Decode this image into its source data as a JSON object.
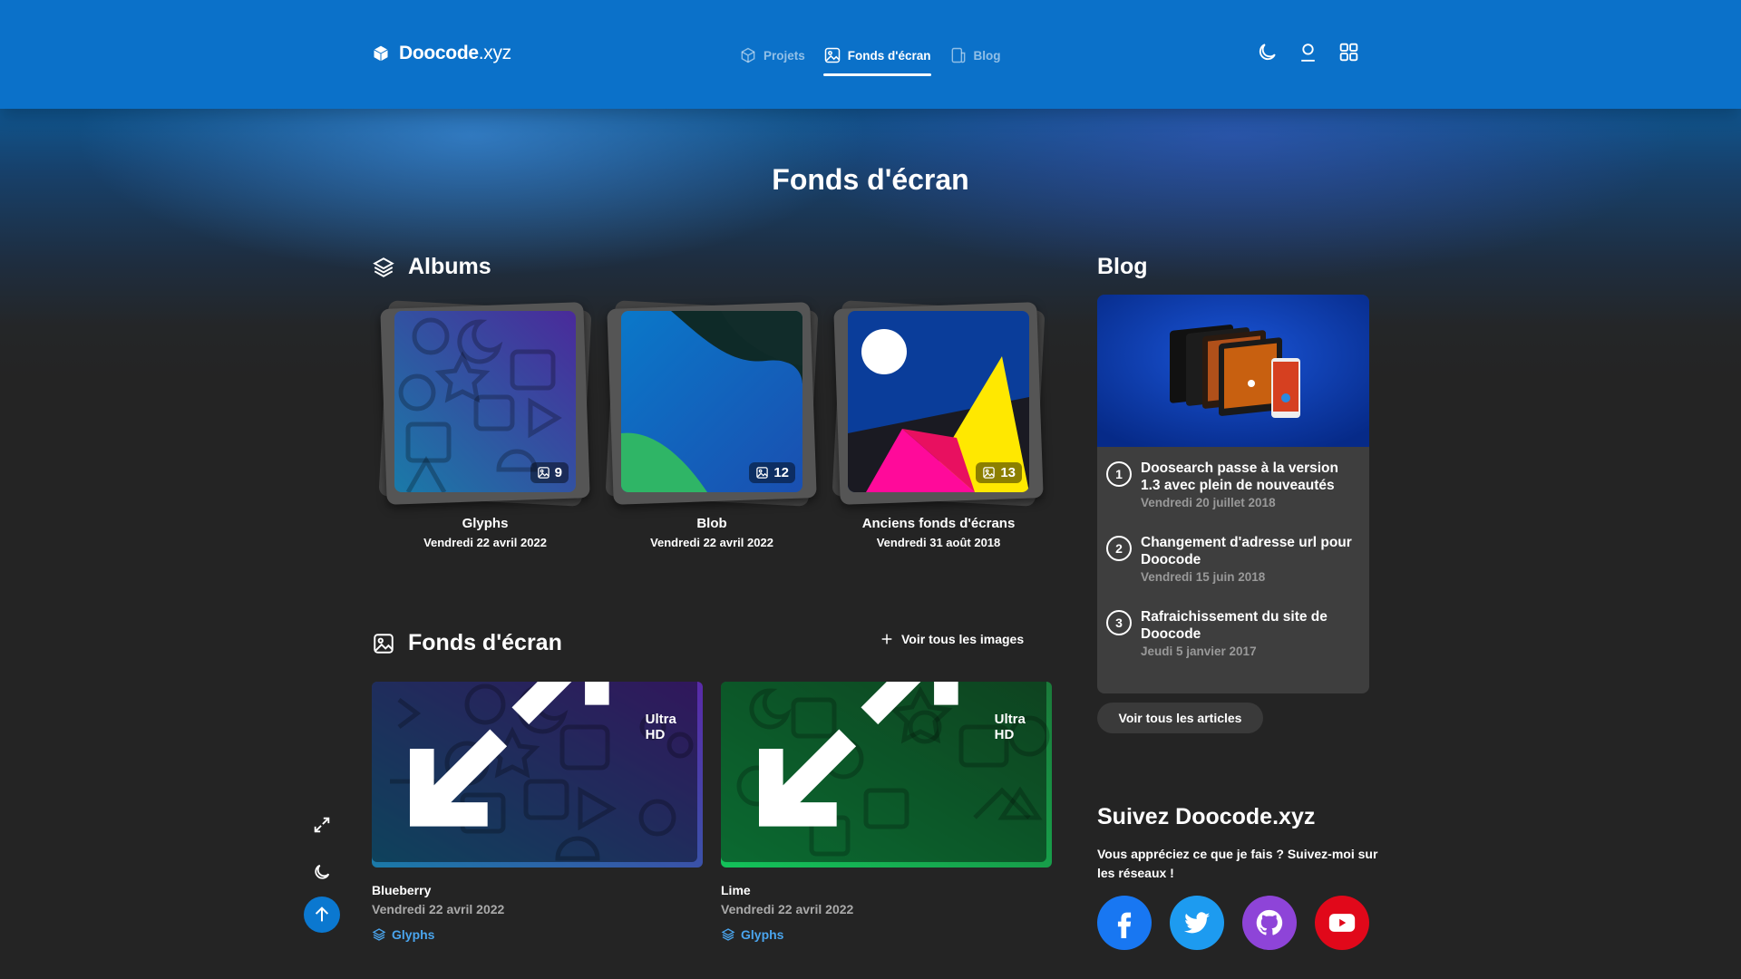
{
  "header": {
    "logo_bold": "Doocode",
    "logo_thin": ".xyz",
    "nav": [
      {
        "label": "Projets",
        "icon": "box-icon"
      },
      {
        "label": "Fonds d'écran",
        "icon": "image-icon",
        "active": true
      },
      {
        "label": "Blog",
        "icon": "document-icon"
      }
    ],
    "actions": [
      "moon-icon",
      "user-icon",
      "apps-grid-icon"
    ]
  },
  "page": {
    "title": "Fonds d'écran"
  },
  "albums": {
    "heading": "Albums",
    "items": [
      {
        "name": "Glyphs",
        "date": "Vendredi 22 avril 2022",
        "count": "9"
      },
      {
        "name": "Blob",
        "date": "Vendredi 22 avril 2022",
        "count": "12"
      },
      {
        "name": "Anciens fonds d'écrans",
        "date": "Vendredi 31 août 2018",
        "count": "13"
      }
    ]
  },
  "wallpapers": {
    "heading": "Fonds d'écran",
    "see_all": "Voir tous les images",
    "items": [
      {
        "name": "Blueberry",
        "date": "Vendredi 22 avril 2022",
        "album": "Glyphs",
        "badge": "Ultra HD"
      },
      {
        "name": "Lime",
        "date": "Vendredi 22 avril 2022",
        "album": "Glyphs",
        "badge": "Ultra HD"
      }
    ]
  },
  "blog": {
    "heading": "Blog",
    "items": [
      {
        "num": "1",
        "title": "Doosearch passe à la version 1.3 avec plein de nouveautés",
        "date": "Vendredi 20 juillet 2018"
      },
      {
        "num": "2",
        "title": "Changement d'adresse url pour Doocode",
        "date": "Vendredi 15 juin 2018"
      },
      {
        "num": "3",
        "title": "Rafraichissement du site de Doocode",
        "date": "Jeudi 5 janvier 2017"
      }
    ],
    "all_articles": "Voir tous les articles"
  },
  "follow": {
    "title": "Suivez Doocode.xyz",
    "text": "Vous appréciez ce que je fais ? Suivez-moi sur les réseaux !",
    "networks": [
      {
        "name": "facebook-icon",
        "color": "#1877f2"
      },
      {
        "name": "twitter-icon",
        "color": "#1d9bf0"
      },
      {
        "name": "github-icon",
        "color": "#8e44d8"
      },
      {
        "name": "youtube-icon",
        "color": "#e1081a"
      }
    ]
  },
  "floating": [
    "fullscreen-icon",
    "moon-icon",
    "arrow-up-icon"
  ],
  "colors": {
    "accent": "#0b71c9",
    "link": "#4aa5ee",
    "card": "#3e3e3e"
  }
}
